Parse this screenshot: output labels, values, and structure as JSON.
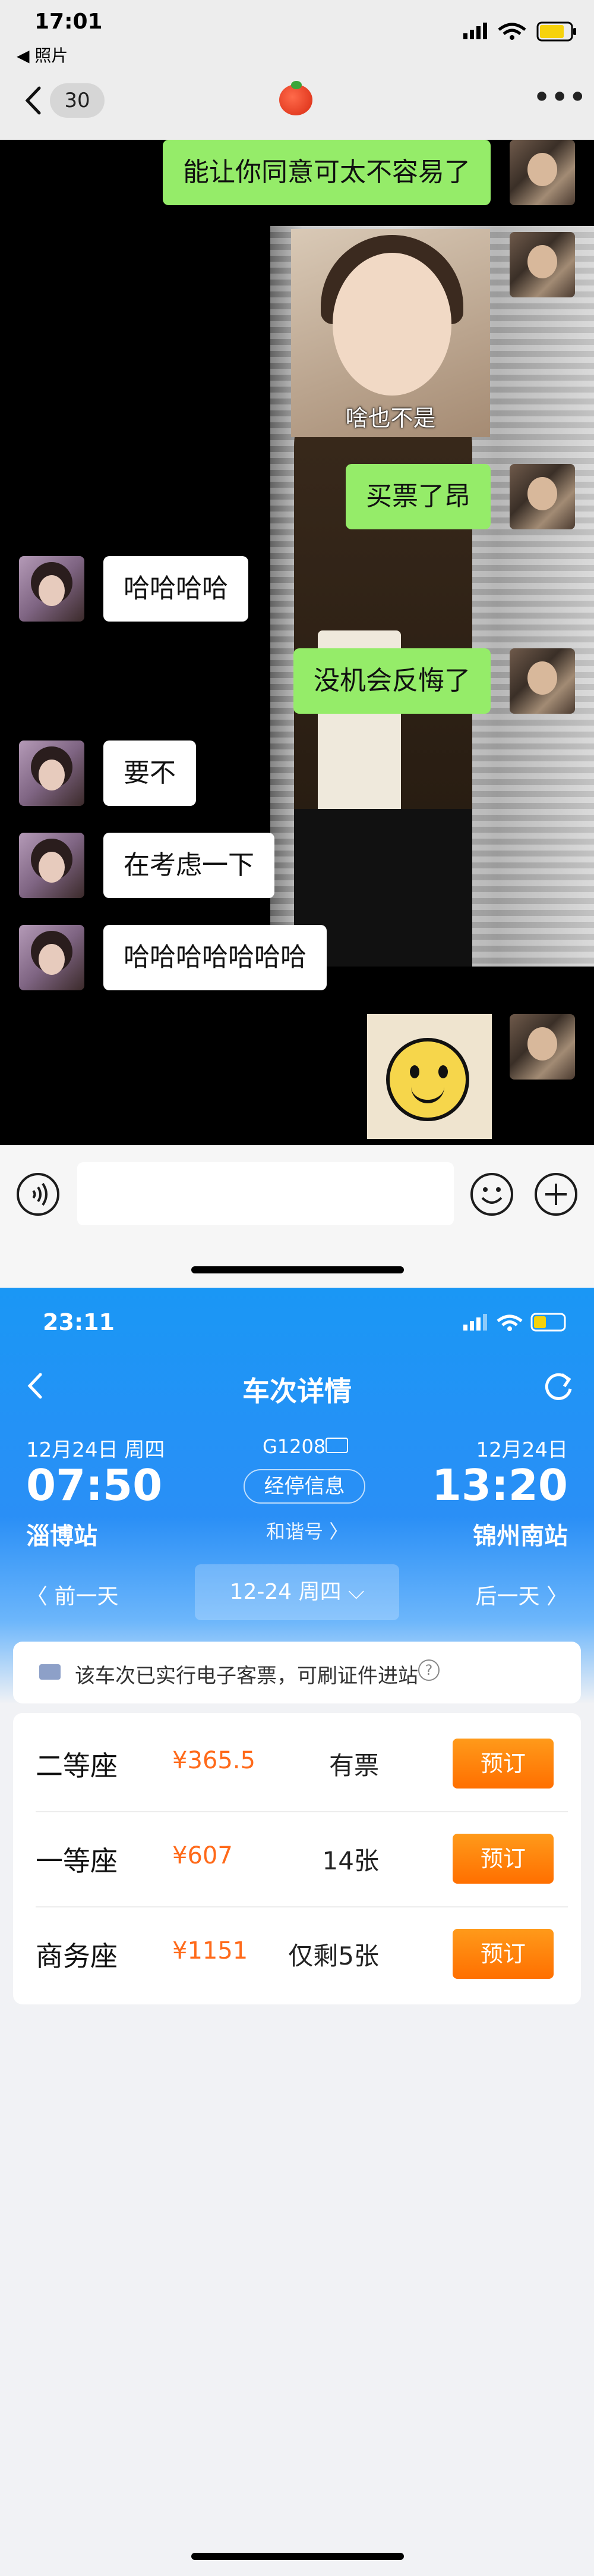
{
  "chat": {
    "status": {
      "time": "17:01",
      "back_app": "◀ 照片"
    },
    "nav": {
      "unread": "30",
      "more": "•••"
    },
    "messages": [
      {
        "side": "me",
        "text": "能让你同意可太不容易了"
      },
      {
        "side": "me",
        "sticker_caption": "啥也不是"
      },
      {
        "side": "me",
        "text": "买票了昂"
      },
      {
        "side": "other",
        "text": "哈哈哈哈"
      },
      {
        "side": "me",
        "text": "没机会反悔了"
      },
      {
        "side": "other",
        "text": "要不"
      },
      {
        "side": "other",
        "text": "在考虑一下"
      },
      {
        "side": "other",
        "text": "哈哈哈哈哈哈哈"
      }
    ]
  },
  "train": {
    "status": {
      "time": "23:11"
    },
    "title": "车次详情",
    "depart": {
      "date": "12月24日 周四",
      "time": "07:50",
      "station": "淄博站"
    },
    "arrive": {
      "date": "12月24日",
      "time": "13:20",
      "station": "锦州南站"
    },
    "train_no": "G1208",
    "stops_label": "经停信息",
    "train_type": "和谐号 〉",
    "prev_day": "〈 前一天",
    "current_day": "12-24 周四",
    "next_day": "后一天 〉",
    "notice": "该车次已实行电子客票，可刷证件进站",
    "seats": [
      {
        "name": "二等座",
        "price": "¥365.5",
        "availability": "有票",
        "button": "预订"
      },
      {
        "name": "一等座",
        "price": "¥607",
        "availability": "14张",
        "button": "预订"
      },
      {
        "name": "商务座",
        "price": "¥1151",
        "availability": "仅剩5张",
        "button": "预订"
      }
    ],
    "colors": {
      "header_blue": "#1a97f5",
      "price_orange": "#ff6a1a",
      "button_orange": "#ff7d00"
    }
  }
}
